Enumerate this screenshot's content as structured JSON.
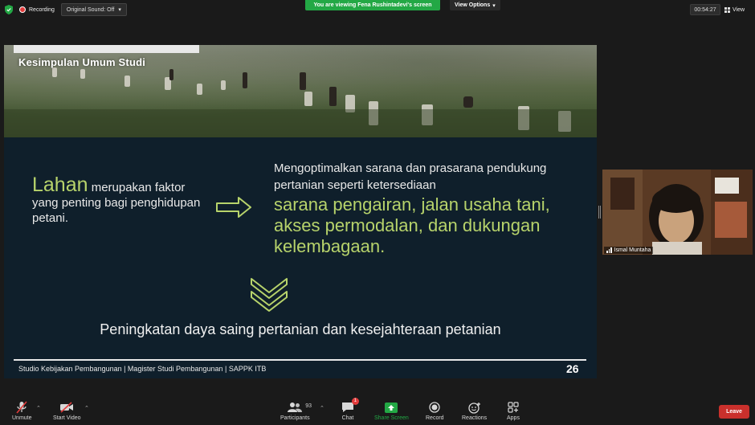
{
  "topbar": {
    "recording_label": "Recording",
    "sound_label": "Original Sound: Off",
    "viewing_banner": "You are viewing Fena Rushintadevi's screen",
    "view_options_label": "View Options",
    "timer": "00:54:27",
    "view_label": "View"
  },
  "slide": {
    "title": "Kesimpulan Umum Studi",
    "left_highlight": "Lahan",
    "left_text": " merupakan faktor yang penting bagi penghidupan petani.",
    "right_text": "Mengoptimalkan sarana dan prasarana pendukung pertanian seperti ketersediaan",
    "right_highlight": "sarana pengairan, jalan usaha tani, akses permodalan, dan dukungan kelembagaan.",
    "conclusion": "Peningkatan daya saing pertanian dan kesejahteraan petanian",
    "footer": "Studio Kebijakan Pembangunan  |  Magister Studi Pembangunan  |  SAPPK ITB",
    "page_number": "26",
    "accent_color": "#b7d36b",
    "background_color": "#0f1f2b"
  },
  "participant_video": {
    "name": "Ismal Muntaha"
  },
  "toolbar": {
    "unmute_label": "Unmute",
    "start_video_label": "Start Video",
    "participants_label": "Participants",
    "participants_count": "93",
    "chat_label": "Chat",
    "chat_badge": "1",
    "share_screen_label": "Share Screen",
    "record_label": "Record",
    "reactions_label": "Reactions",
    "apps_label": "Apps",
    "leave_label": "Leave",
    "share_color": "#23a845",
    "leave_color": "#c9302c"
  }
}
